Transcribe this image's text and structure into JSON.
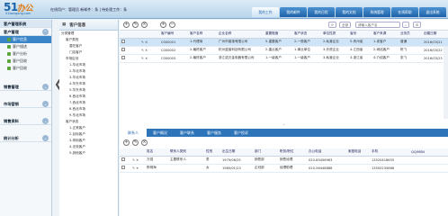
{
  "header": {
    "logo_main": "51",
    "logo_sub": "办公",
    "logo_url": "51bangong.com",
    "welcome": "在线用户：管理员 新邮件：条 | 待处理工作：条"
  },
  "nav_tabs": [
    "我的工作",
    "我的邮件",
    "我的日程",
    "我的文档",
    "系统管理",
    "在线帮助",
    "退出系统"
  ],
  "left_menu": {
    "section": "客户管理系统",
    "groups": [
      {
        "label": "客户管理",
        "items": [
          "客户信息",
          "客户描述",
          "客户分析",
          "客户回收",
          "客户回收"
        ]
      },
      {
        "label": "销售管理",
        "items": []
      },
      {
        "label": "市场营销",
        "items": []
      },
      {
        "label": "销售资料",
        "items": []
      },
      {
        "label": "统计分析",
        "items": []
      }
    ]
  },
  "tree": {
    "title": "客户信息",
    "nodes": [
      "分类管理",
      "客户类别",
      "潜在客户",
      "门店客户",
      "市场区划",
      "1-华北市场",
      "2-华北市场",
      "3-华北市场",
      "4-华东市场",
      "5-华东市场",
      "6-西北市场",
      "7-西北市场",
      "8-西北市场",
      "9-东北市场",
      "客户状态",
      "1-正常客户",
      "2-目标客户",
      "3-停用客户",
      "4-无效客户",
      "5-其他客户"
    ]
  },
  "main": {
    "filter_pill": "全部",
    "search_pill": "请输入客户名",
    "columns": [
      "客户编号",
      "客户名称",
      "企业名称",
      "重要程度",
      "客户状态",
      "单位性质",
      "省份",
      "客户来源",
      "业务员",
      "创建日期"
    ],
    "rows": [
      [
        "C000001",
        "1-代理商",
        "广州市普惠有限公司",
        "5-重要客户",
        "2-一般客户",
        "2-私营企业",
        "5-贵州省",
        "1-老客户",
        "普通",
        "2016/03/21"
      ],
      [
        "C000002",
        "2-最终客户",
        "杭州蓝普科技有限公司",
        "2-重点客户",
        "1-事业单位",
        "3-外资企业",
        "4-江西省",
        "2-网站客户",
        "陈飞",
        "2016/03/22"
      ],
      [
        "C000003",
        "2-最终客户",
        "浙江诺贝金电器有限公司",
        "1-一级客户",
        "1-一级客户",
        "3-私营企业",
        "3-浙江省",
        "4-介绍客户",
        "张飞",
        "2016/03/23"
      ]
    ],
    "tabs": [
      "联系人",
      "客户概况",
      "客户联系",
      "客户服务",
      "客户投诉"
    ],
    "contact_columns": [
      "姓名",
      "联系人类别",
      "性别",
      "出生日期",
      "部门",
      "职务/职位",
      "办公电话",
      "家庭电话",
      "手机",
      "QQ/MSN"
    ],
    "contact_rows": [
      [
        "万强",
        "主要联系人",
        "男",
        "1979/06/25",
        "销售部",
        "销售经理",
        "020-85456963",
        "",
        "13520418655",
        ""
      ],
      [
        "陈明海",
        "",
        "女",
        "1985/01/23",
        "企划部",
        "经理助理",
        "020-56448888",
        "",
        "13500235866",
        ""
      ]
    ]
  }
}
